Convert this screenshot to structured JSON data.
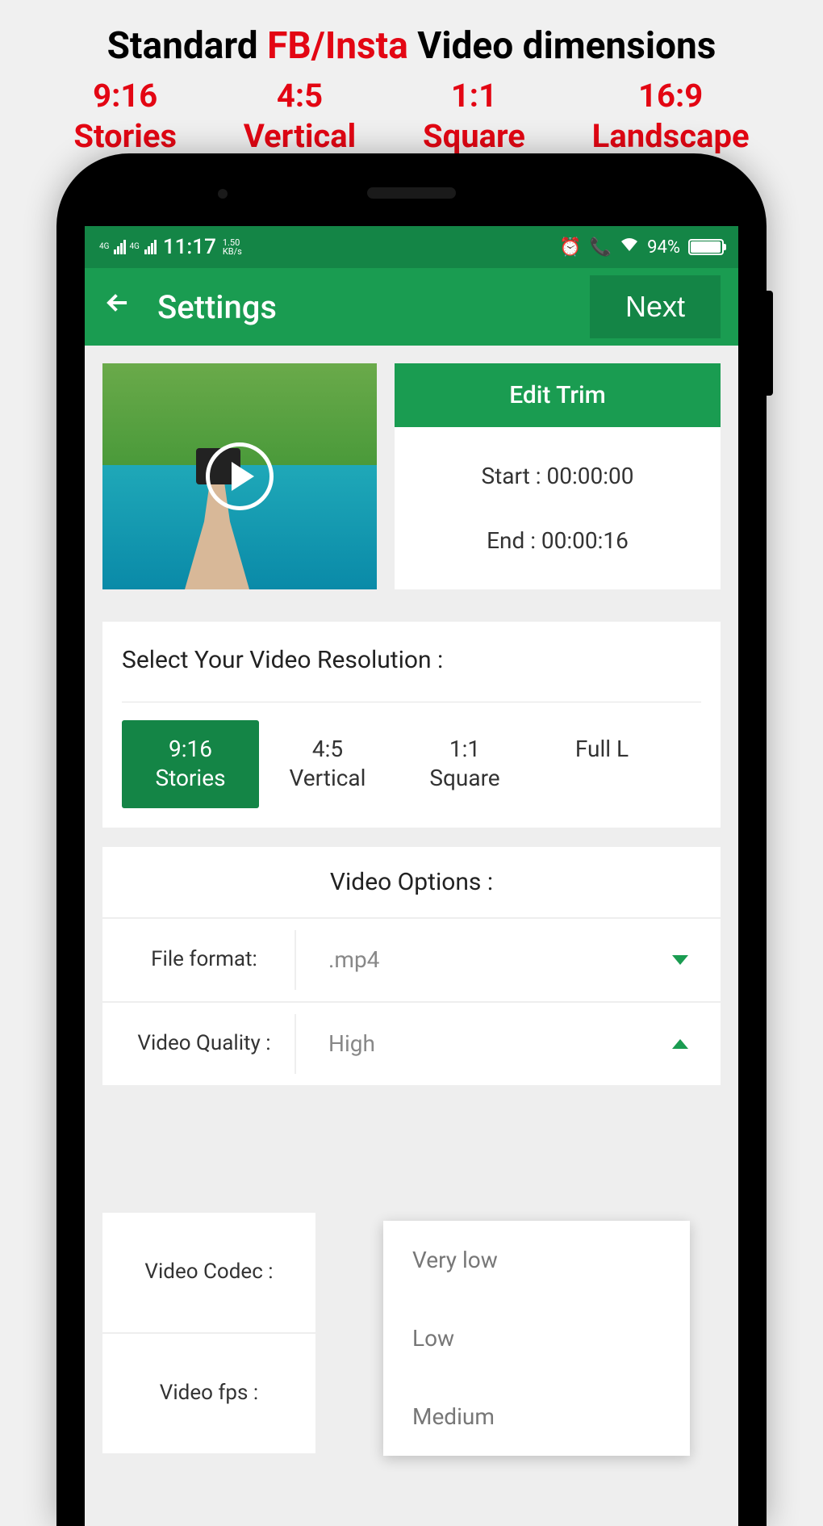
{
  "promo": {
    "title_pre": "Standard ",
    "title_highlight": "FB/Insta",
    "title_post": " Video dimensions",
    "ratios": [
      {
        "ratio": "9:16",
        "label": "Stories"
      },
      {
        "ratio": "4:5",
        "label": "Vertical"
      },
      {
        "ratio": "1:1",
        "label": "Square"
      },
      {
        "ratio": "16:9",
        "label": "Landscape"
      }
    ]
  },
  "status": {
    "net1": "4G",
    "net2": "4G",
    "time": "11:17",
    "kbs_top": "1.50",
    "kbs_bot": "KB/s",
    "battery_pct": "94%"
  },
  "appbar": {
    "title": "Settings",
    "next": "Next"
  },
  "trim": {
    "header": "Edit Trim",
    "start_label": "Start : ",
    "start_value": "00:00:00",
    "end_label": "End : ",
    "end_value": "00:00:16"
  },
  "resolution": {
    "title": "Select Your Video Resolution :",
    "options": [
      {
        "ratio": "9:16",
        "label": "Stories",
        "selected": true
      },
      {
        "ratio": "4:5",
        "label": "Vertical",
        "selected": false
      },
      {
        "ratio": "1:1",
        "label": "Square",
        "selected": false
      },
      {
        "ratio": "",
        "label": "Full L",
        "selected": false
      }
    ]
  },
  "video_options": {
    "title": "Video Options :",
    "rows": [
      {
        "label": "File format:",
        "value": ".mp4",
        "caret": "down"
      },
      {
        "label": "Video Quality :",
        "value": "High",
        "caret": "up"
      },
      {
        "label": "Video Codec :",
        "value": ""
      },
      {
        "label": "Video fps :",
        "value": ""
      }
    ],
    "dropdown": [
      "Very low",
      "Low",
      "Medium"
    ]
  }
}
